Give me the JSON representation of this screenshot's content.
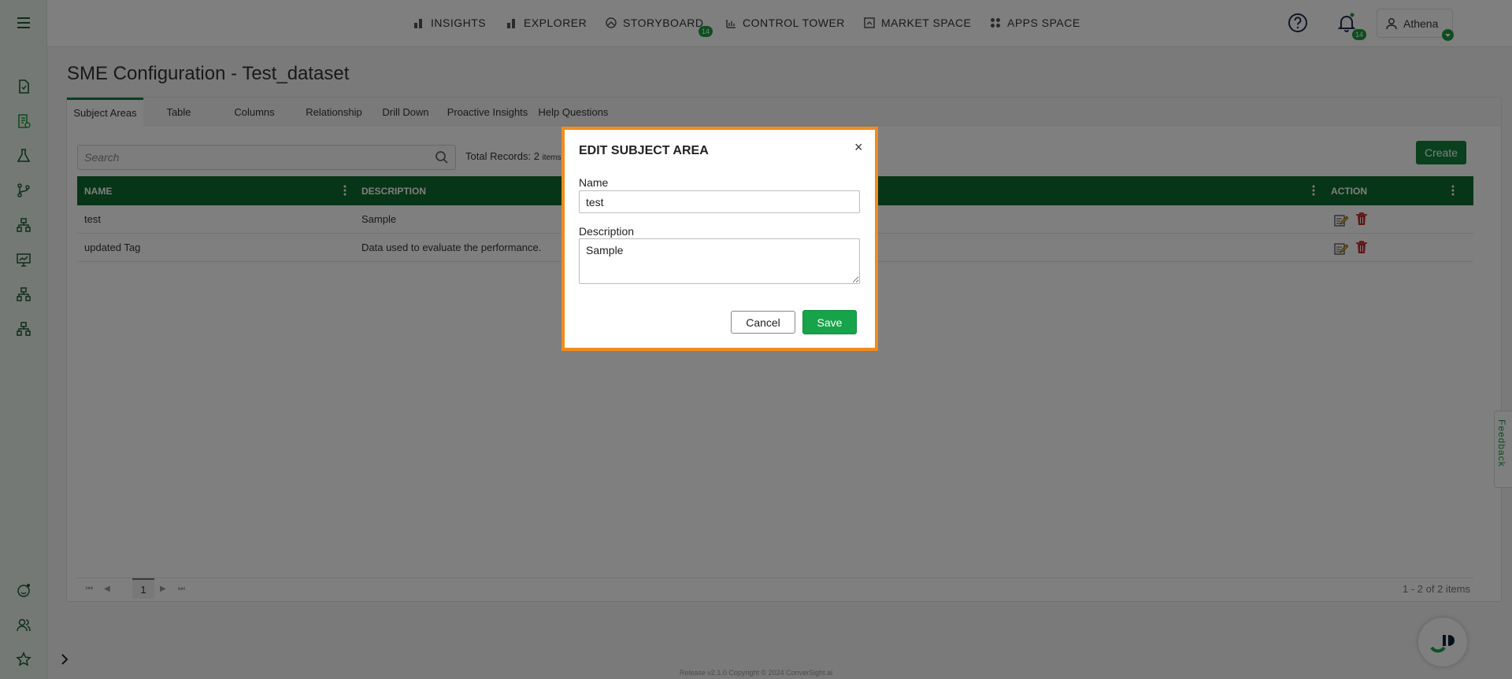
{
  "nav": {
    "items": [
      {
        "label": "INSIGHTS",
        "icon": "bar-chart-icon"
      },
      {
        "label": "EXPLORER",
        "icon": "bar-chart-icon"
      },
      {
        "label": "STORYBOARD",
        "icon": "storyboard-icon",
        "badge": "14"
      },
      {
        "label": "CONTROL TOWER",
        "icon": "control-tower-icon"
      },
      {
        "label": "MARKET SPACE",
        "icon": "market-space-icon"
      },
      {
        "label": "APPS SPACE",
        "icon": "apps-space-icon"
      }
    ],
    "notification_badge": "14",
    "user_name": "Athena"
  },
  "page": {
    "title": "SME Configuration - Test_dataset",
    "tabs": [
      "Subject Areas",
      "Table",
      "Columns",
      "Relationship",
      "Drill Down",
      "Proactive Insights",
      "Help Questions"
    ],
    "active_tab": "Subject Areas",
    "search_placeholder": "Search",
    "total_label": "Total Records: 2",
    "total_unit": "items",
    "create_label": "Create"
  },
  "grid": {
    "headers": {
      "name": "NAME",
      "description": "DESCRIPTION",
      "action": "ACTION"
    },
    "rows": [
      {
        "name": "test",
        "description": "Sample"
      },
      {
        "name": "updated Tag",
        "description": "Data used to evaluate the performance."
      }
    ]
  },
  "pager": {
    "page": "1",
    "info": "1 - 2 of 2 items"
  },
  "footer": "Release v2.1.0 Copyright © 2024 ConverSight.ai",
  "feedback_label": "Feedback",
  "modal": {
    "title": "EDIT SUBJECT AREA",
    "close": "×",
    "name_label": "Name",
    "name_value": "test",
    "description_label": "Description",
    "description_value": "Sample",
    "cancel_label": "Cancel",
    "save_label": "Save"
  },
  "colors": {
    "brand_green": "#12803a",
    "header_green": "#0e6a2e",
    "modal_border": "#f28b1c",
    "save_green": "#16a34a",
    "delete_red": "#c62828"
  }
}
